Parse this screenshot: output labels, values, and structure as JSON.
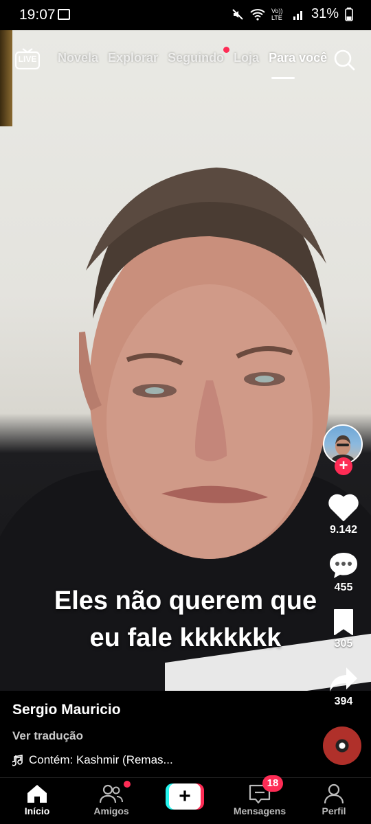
{
  "status_bar": {
    "time": "19:07",
    "network": "Vo)) LTE",
    "battery": "31%"
  },
  "top_nav": {
    "live_label": "LIVE",
    "tabs": [
      "Novela",
      "Explorar",
      "Seguindo",
      "Loja",
      "Para você"
    ],
    "active_tab": "Para você"
  },
  "video": {
    "caption_line1": "Eles não querem que",
    "caption_line2": "eu fale kkkkkkk"
  },
  "actions": {
    "likes": "9.142",
    "comments": "455",
    "saves": "305",
    "shares": "394"
  },
  "post": {
    "username": "Sergio Mauricio",
    "translate_label": "Ver tradução",
    "music": "Contém: Kashmir (Remas..."
  },
  "bottom_nav": {
    "home": "Início",
    "friends": "Amigos",
    "create": "+",
    "messages": "Mensagens",
    "messages_badge": "18",
    "profile": "Perfil"
  },
  "colors": {
    "accent": "#fe2c55",
    "cyan": "#25f4ee"
  }
}
